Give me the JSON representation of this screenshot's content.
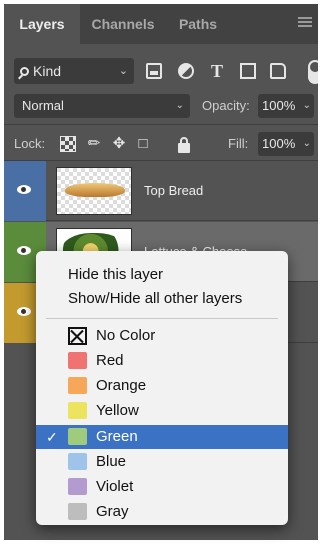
{
  "tabs": [
    {
      "label": "Layers"
    },
    {
      "label": "Channels"
    },
    {
      "label": "Paths"
    }
  ],
  "filter": {
    "kind_label": "Kind"
  },
  "blend": {
    "mode": "Normal",
    "opacity_label": "Opacity:",
    "opacity_value": "100%"
  },
  "lock": {
    "label": "Lock:",
    "fill_label": "Fill:",
    "fill_value": "100%"
  },
  "layers": [
    {
      "name": "Top Bread",
      "color": "#4a6fa5"
    },
    {
      "name": "Lettuce & Cheese",
      "color": "#5b8c3c"
    },
    {
      "name": "",
      "color": "#c39a2e"
    }
  ],
  "context_menu": {
    "items": [
      {
        "label": "Hide this layer"
      },
      {
        "label": "Show/Hide all other layers"
      }
    ],
    "colors": [
      {
        "label": "No Color",
        "swatch": ""
      },
      {
        "label": "Red",
        "swatch": "#f07372"
      },
      {
        "label": "Orange",
        "swatch": "#f6a75a"
      },
      {
        "label": "Yellow",
        "swatch": "#ece35f"
      },
      {
        "label": "Green",
        "swatch": "#9ecb7c",
        "selected": true
      },
      {
        "label": "Blue",
        "swatch": "#9ec4ea"
      },
      {
        "label": "Violet",
        "swatch": "#b39bd0"
      },
      {
        "label": "Gray",
        "swatch": "#bdbdbd"
      }
    ]
  }
}
